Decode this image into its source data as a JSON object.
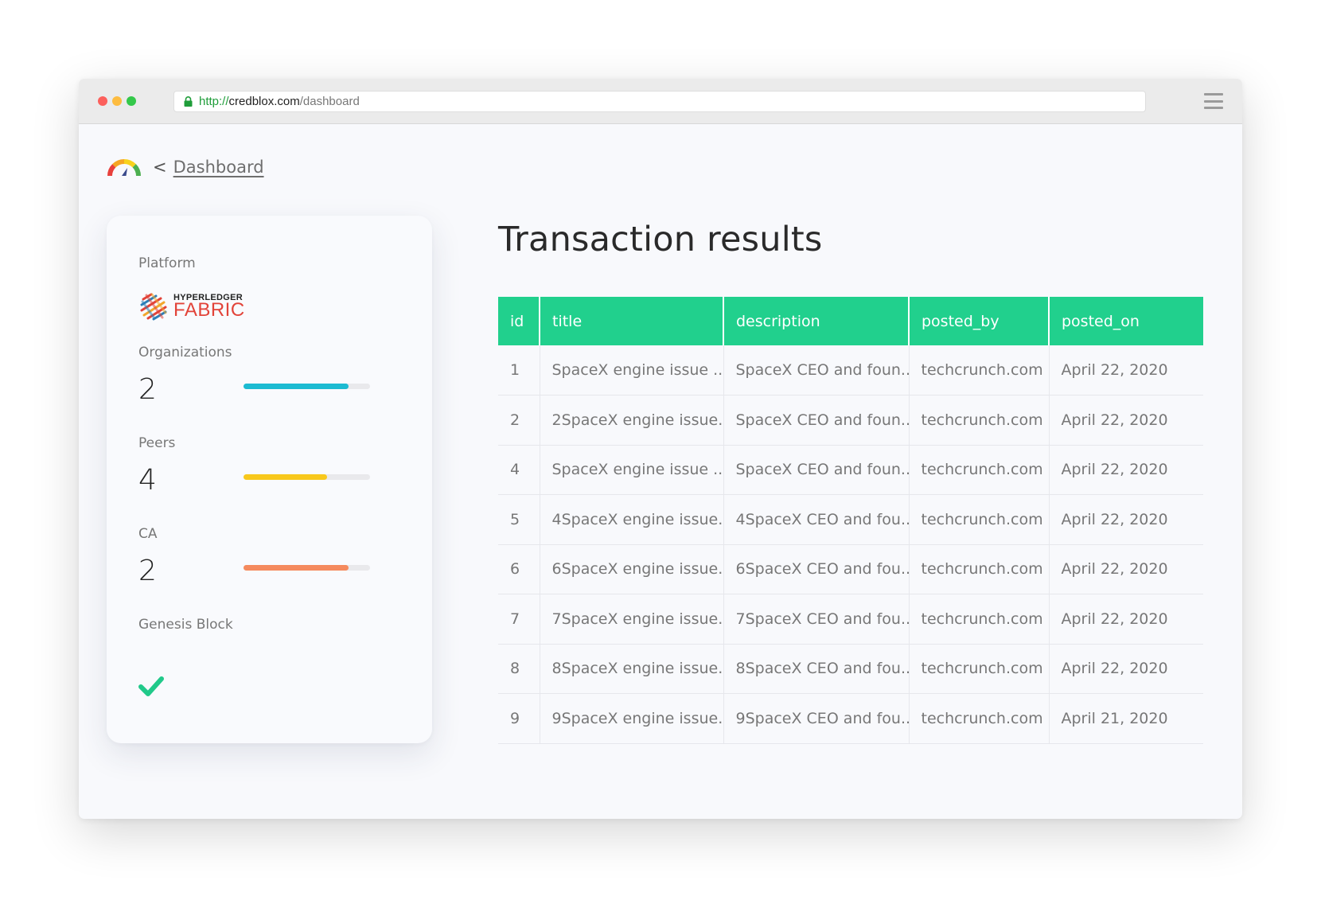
{
  "browser": {
    "url_scheme": "http://",
    "url_host": "credblox.com",
    "url_path": "/dashboard"
  },
  "breadcrumb": {
    "chevron": "<",
    "link": "Dashboard"
  },
  "sidebar": {
    "platform_label": "Platform",
    "platform_logo_top": "HYPERLEDGER",
    "platform_logo_bottom": "FABRIC",
    "stats": [
      {
        "label": "Organizations",
        "value": "2",
        "fill_pct": 83,
        "color": "#1cbbd2"
      },
      {
        "label": "Peers",
        "value": "4",
        "fill_pct": 66,
        "color": "#f8c81c"
      },
      {
        "label": "CA",
        "value": "2",
        "fill_pct": 83,
        "color": "#f58a5e"
      }
    ],
    "genesis_label": "Genesis Block",
    "genesis_status": "check-icon",
    "check_color": "#21c98a"
  },
  "main": {
    "title": "Transaction results",
    "header_color": "#21d08d",
    "columns": [
      "id",
      "title",
      "description",
      "posted_by",
      "posted_on"
    ],
    "rows": [
      [
        "1",
        "SpaceX engine issue ...",
        "SpaceX CEO and foun...",
        "techcrunch.com",
        "April 22, 2020"
      ],
      [
        "2",
        "2SpaceX engine issue...",
        "SpaceX CEO and foun...",
        "techcrunch.com",
        "April 22, 2020"
      ],
      [
        "4",
        "SpaceX engine issue ...",
        "SpaceX CEO and foun...",
        "techcrunch.com",
        "April 22, 2020"
      ],
      [
        "5",
        "4SpaceX engine issue...",
        "4SpaceX CEO and fou...",
        "techcrunch.com",
        "April 22, 2020"
      ],
      [
        "6",
        "6SpaceX engine issue...",
        "6SpaceX CEO and fou...",
        "techcrunch.com",
        "April 22, 2020"
      ],
      [
        "7",
        "7SpaceX engine issue...",
        "7SpaceX CEO and fou...",
        "techcrunch.com",
        "April 22, 2020"
      ],
      [
        "8",
        "8SpaceX engine issue...",
        "8SpaceX CEO and fou...",
        "techcrunch.com",
        "April 22, 2020"
      ],
      [
        "9",
        "9SpaceX engine issue...",
        "9SpaceX CEO and fou...",
        "techcrunch.com",
        "April 21, 2020"
      ]
    ]
  }
}
